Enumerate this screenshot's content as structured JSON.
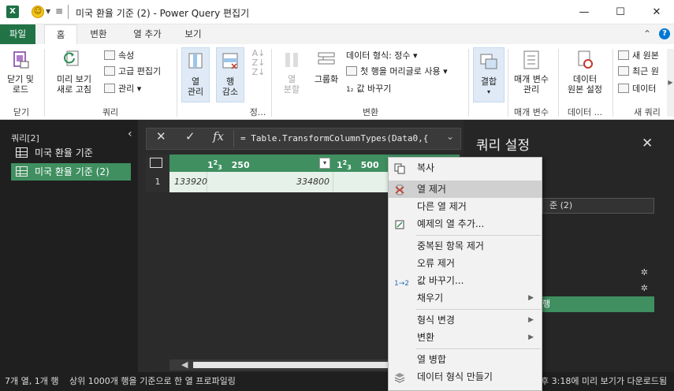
{
  "window": {
    "title": "미국 환율 기준 (2) - Power Query 편집기",
    "app_logo": "X",
    "controls": [
      "—",
      "☐",
      "✕"
    ]
  },
  "ribbon_tabs": {
    "file": "파일",
    "home": "홈",
    "transform": "변환",
    "add_column": "열 추가",
    "view": "보기"
  },
  "ribbon": {
    "close_load": "닫기 및\n로드",
    "close_group": "닫기",
    "refresh_preview": "미리 보기\n새로 고침",
    "properties": "속성",
    "advanced_editor": "고급 편집기",
    "manage": "관리",
    "query_group": "쿼리",
    "manage_columns": "열\n관리",
    "reduce_rows": "행\n감소",
    "sort_group": "정...",
    "split_column": "열\n분할",
    "group_by": "그룹화",
    "data_type": "데이터 형식: 정수",
    "use_first_row": "첫 행을 머리글로 사용",
    "replace_values": "값 바꾸기",
    "transform_group": "변환",
    "combine": "결합",
    "manage_params": "매개 변수\n관리",
    "params_group": "매개 변수",
    "data_source_settings": "데이터\n원본 설정",
    "data_source_group": "데이터 ...",
    "new_source": "새 원본",
    "recent_sources": "최근 원",
    "enter_data": "데이터",
    "new_query_group": "새 쿼리"
  },
  "queries_pane": {
    "header": "쿼리[2]",
    "items": [
      {
        "label": "미국 환율 기준"
      },
      {
        "label": "미국 환율 기준 (2)"
      }
    ]
  },
  "formula_bar": {
    "cancel": "✕",
    "commit": "✓",
    "fx": "fx",
    "formula": "= Table.TransformColumnTypes(Data0,{"
  },
  "grid": {
    "columns": [
      {
        "type_prefix": "1",
        "type_sup": "2",
        "type_sub": "3",
        "name": ""
      },
      {
        "type_prefix": "1",
        "type_sup": "2",
        "type_sub": "3",
        "name": "250"
      },
      {
        "type_prefix": "1",
        "type_sup": "2",
        "type_sub": "3",
        "name": "500"
      }
    ],
    "rows": [
      {
        "num": "1",
        "cells": [
          "133920",
          "334800"
        ]
      }
    ]
  },
  "settings_pane": {
    "title": "쿼리 설정",
    "name_value": "준 (2)",
    "step_active_label": "행"
  },
  "status_bar": {
    "left": "7개 열, 1개 행",
    "middle": "상위 1000개 행을 기준으로 한 열 프로파일링",
    "right": "후 3:18에 미리 보기가 다운로드됨"
  },
  "context_menu": {
    "items": [
      {
        "label": "복사",
        "icon": "copy-icon"
      },
      {
        "label": "열 제거",
        "icon": "remove-column-icon",
        "highlighted": true
      },
      {
        "label": "다른 열 제거",
        "icon": ""
      },
      {
        "label": "예제의 열 추가...",
        "icon": "column-from-examples-icon"
      },
      {
        "label": "중복된 항목 제거",
        "icon": ""
      },
      {
        "label": "오류 제거",
        "icon": ""
      },
      {
        "label": "값 바꾸기...",
        "icon": "replace-values-icon"
      },
      {
        "label": "채우기",
        "icon": "",
        "submenu": true
      },
      {
        "label": "형식 변경",
        "icon": "",
        "submenu": true
      },
      {
        "label": "변환",
        "icon": "",
        "submenu": true
      },
      {
        "label": "열 병합",
        "icon": ""
      },
      {
        "label": "데이터 형식 만들기",
        "icon": "create-data-type-icon"
      }
    ],
    "submenu_arrow": "▶"
  }
}
